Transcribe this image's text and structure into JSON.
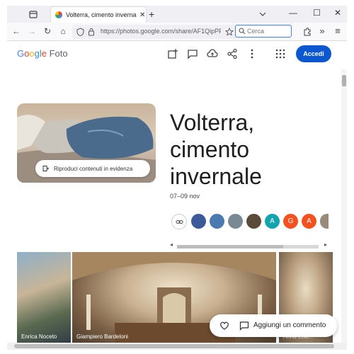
{
  "browser": {
    "tab_title": "Volterra, cimento invernale - Goo",
    "tab_close": "✕",
    "new_tab": "+",
    "url_text": "https://photos.google.com/share/AF1QipPFE",
    "search_placeholder": "Cerca",
    "window_min": "—",
    "window_max": "☐",
    "window_close": "✕",
    "overflow_glyph": "»",
    "menu_glyph": "≡",
    "back_glyph": "←",
    "forward_glyph": "→",
    "reload_glyph": "↻",
    "home_glyph": "⌂"
  },
  "header": {
    "logo_google": [
      "G",
      "o",
      "o",
      "g",
      "l",
      "e"
    ],
    "logo_product": " Foto",
    "login_label": "Accedi"
  },
  "album": {
    "title": "Volterra, cimento invernale",
    "date": "07–09 nov",
    "highlight_label": "Riproduci contenuti in evidenza"
  },
  "avatars": [
    {
      "letter": "",
      "color": "#3c5a99"
    },
    {
      "letter": "",
      "color": "#4a7ab0"
    },
    {
      "letter": "",
      "color": "#7a8a94"
    },
    {
      "letter": "",
      "color": "#5a4a3a"
    },
    {
      "letter": "A",
      "color": "#12a4af"
    },
    {
      "letter": "G",
      "color": "#f4511e"
    },
    {
      "letter": "A",
      "color": "#f4511e"
    },
    {
      "letter": "",
      "color": "#9a8a7a"
    }
  ],
  "photos": [
    {
      "caption": "Enrica Noceto"
    },
    {
      "caption": "Giampiero Bardeloni"
    },
    {
      "caption": "Anna Lisa..."
    }
  ],
  "comment_bar": {
    "label": "Aggiungi un commento"
  }
}
